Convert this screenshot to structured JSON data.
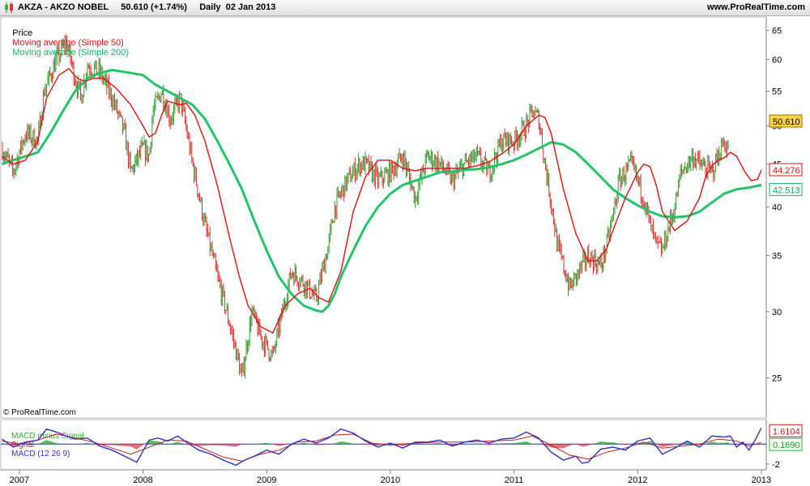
{
  "header": {
    "title": "AKZA - AKZO NOBEL     50.610 (+1.74%)     Daily  02 Jan 2013",
    "site": "www.ProRealTime.com"
  },
  "legend": {
    "price": "Price",
    "ma50": "Moving average (Simple 50)",
    "ma200": "Moving average (Simple 200)"
  },
  "macd_legend": {
    "hist": "MACD minus Signal",
    "signal": "Signal",
    "macd": "MACD (12 26 9)"
  },
  "credit": "© ProRealTime.com",
  "colors": {
    "price_up": "#2e9e2e",
    "price_down": "#d83030",
    "ma50": "#e01010",
    "ma200": "#22c46a",
    "macd": "#3030c0",
    "signal": "#c02020",
    "hist": "#30b030"
  },
  "chart_data": [
    {
      "type": "line",
      "name": "price-panel",
      "x_ticks": [
        "2007",
        "2008",
        "2009",
        "2010",
        "2011",
        "2012",
        "2013"
      ],
      "y_ticks": [
        25,
        30,
        35,
        40,
        45,
        50,
        55,
        60,
        65
      ],
      "y_scale": "log",
      "ylim": [
        22.5,
        67
      ],
      "xlim": [
        2006.85,
        2013.04
      ],
      "last_price_label": "50.610",
      "ma50_label": "44.276",
      "ma200_label": "42.513",
      "series": [
        {
          "name": "Price",
          "role": "price",
          "x": [
            2006.86,
            2006.95,
            2007.05,
            2007.15,
            2007.2,
            2007.3,
            2007.38,
            2007.45,
            2007.5,
            2007.55,
            2007.65,
            2007.75,
            2007.85,
            2007.9,
            2008.0,
            2008.05,
            2008.08,
            2008.15,
            2008.22,
            2008.3,
            2008.4,
            2008.5,
            2008.6,
            2008.7,
            2008.75,
            2008.8,
            2008.85,
            2008.88,
            2008.95,
            2009.05,
            2009.15,
            2009.2,
            2009.3,
            2009.4,
            2009.5,
            2009.55,
            2009.65,
            2009.75,
            2009.8,
            2009.9,
            2010.0,
            2010.1,
            2010.2,
            2010.3,
            2010.4,
            2010.5,
            2010.6,
            2010.7,
            2010.8,
            2010.9,
            2011.0,
            2011.1,
            2011.15,
            2011.2,
            2011.25,
            2011.35,
            2011.45,
            2011.55,
            2011.6,
            2011.7,
            2011.75,
            2011.8,
            2011.85,
            2011.95,
            2012.05,
            2012.1,
            2012.15,
            2012.2,
            2012.3,
            2012.35,
            2012.4,
            2012.45,
            2012.5,
            2012.6,
            2012.65,
            2012.7,
            2012.75,
            2012.8,
            2012.85,
            2012.9,
            2012.95,
            2013.0
          ],
          "values": [
            47,
            44,
            49,
            48,
            55,
            60,
            63,
            57,
            54,
            59,
            58,
            54,
            49,
            44,
            47,
            46,
            52,
            55,
            51,
            54,
            45,
            38,
            33,
            29,
            27,
            25,
            28,
            30,
            28,
            26.5,
            31,
            33.5,
            32.5,
            31,
            36,
            40,
            43,
            45,
            45,
            43,
            44,
            46,
            41,
            46,
            45,
            43,
            45,
            46,
            44,
            48,
            48,
            50,
            52,
            51,
            45,
            36,
            32,
            34,
            35,
            34,
            36,
            39,
            43,
            45,
            41,
            38,
            36,
            35.5,
            40,
            44,
            45,
            46,
            45,
            44,
            46,
            48,
            46,
            44,
            42,
            44,
            49,
            50.61
          ]
        },
        {
          "name": "Moving average (Simple 50)",
          "role": "ma50",
          "x": [
            2006.86,
            2006.95,
            2007.05,
            2007.15,
            2007.22,
            2007.32,
            2007.4,
            2007.47,
            2007.53,
            2007.6,
            2007.68,
            2007.78,
            2007.9,
            2008.0,
            2008.05,
            2008.1,
            2008.15,
            2008.2,
            2008.3,
            2008.35,
            2008.42,
            2008.5,
            2008.6,
            2008.7,
            2008.78,
            2008.85,
            2008.95,
            2009.05,
            2009.15,
            2009.25,
            2009.35,
            2009.42,
            2009.5,
            2009.6,
            2009.7,
            2009.8,
            2009.9,
            2010.0,
            2010.1,
            2010.2,
            2010.3,
            2010.4,
            2010.5,
            2010.6,
            2010.7,
            2010.8,
            2010.9,
            2011.0,
            2011.1,
            2011.2,
            2011.25,
            2011.3,
            2011.4,
            2011.5,
            2011.6,
            2011.67,
            2011.75,
            2011.8,
            2011.9,
            2012.0,
            2012.05,
            2012.1,
            2012.15,
            2012.2,
            2012.3,
            2012.4,
            2012.5,
            2012.55,
            2012.6,
            2012.65,
            2012.7,
            2012.75,
            2012.8,
            2012.87,
            2012.92,
            2012.97,
            2013.0
          ],
          "values": [
            46,
            45,
            45.5,
            48,
            54,
            57.5,
            58.5,
            57,
            56.5,
            57,
            57,
            55.5,
            53,
            50,
            48.5,
            49,
            51.5,
            53.5,
            53,
            53.2,
            51.5,
            48,
            42.5,
            36.8,
            33,
            30.5,
            28.8,
            28.3,
            30.5,
            31.5,
            32,
            31.2,
            30.8,
            33.5,
            39.5,
            43.5,
            45.5,
            45.5,
            44.5,
            44.2,
            44.5,
            44.5,
            44.5,
            44.5,
            44.8,
            45.3,
            46.3,
            47.5,
            50,
            51.5,
            51.2,
            49,
            42,
            37.2,
            34.5,
            34.5,
            35.7,
            37.5,
            41,
            44,
            45,
            44.7,
            42.5,
            39.5,
            37.5,
            38.5,
            41,
            43.5,
            44.8,
            45.5,
            45.8,
            46.5,
            46,
            44,
            43,
            43.2,
            44.28
          ]
        },
        {
          "name": "Moving average (Simple 200)",
          "role": "ma200",
          "x": [
            2006.86,
            2006.95,
            2007.05,
            2007.15,
            2007.25,
            2007.35,
            2007.45,
            2007.55,
            2007.65,
            2007.75,
            2007.85,
            2008.0,
            2008.1,
            2008.2,
            2008.3,
            2008.4,
            2008.5,
            2008.6,
            2008.7,
            2008.8,
            2008.9,
            2009.0,
            2009.1,
            2009.2,
            2009.3,
            2009.35,
            2009.4,
            2009.45,
            2009.5,
            2009.55,
            2009.6,
            2009.7,
            2009.8,
            2009.9,
            2010.0,
            2010.1,
            2010.2,
            2010.3,
            2010.4,
            2010.5,
            2010.6,
            2010.7,
            2010.8,
            2010.9,
            2011.0,
            2011.1,
            2011.2,
            2011.3,
            2011.4,
            2011.5,
            2011.6,
            2011.7,
            2011.8,
            2011.9,
            2012.0,
            2012.1,
            2012.2,
            2012.3,
            2012.4,
            2012.5,
            2012.6,
            2012.7,
            2012.8,
            2012.9,
            2013.0
          ],
          "values": [
            45,
            45.5,
            46,
            46.5,
            49,
            52,
            55,
            57,
            57.8,
            58.3,
            58,
            57.5,
            56,
            55,
            54,
            53,
            51,
            48,
            45,
            42,
            38.5,
            35.5,
            33,
            31.5,
            30.5,
            30.3,
            30.1,
            30,
            30.5,
            31.5,
            33,
            35.5,
            38,
            40,
            41.5,
            42.5,
            43,
            43.5,
            44,
            44.1,
            44.3,
            44.4,
            44.6,
            45,
            45.5,
            46.2,
            47,
            47.8,
            47.5,
            46.5,
            45,
            43.5,
            42,
            41,
            40.2,
            39.5,
            39,
            38.9,
            39,
            39.5,
            40.5,
            41.5,
            42,
            42.2,
            42.5
          ]
        }
      ]
    },
    {
      "type": "line",
      "name": "macd-panel",
      "y_ticks": [
        -2
      ],
      "ylim": [
        -2.4,
        2.2
      ],
      "macd_label": "1.6104",
      "signal_label": "0.1690",
      "series": [
        {
          "name": "MACD (12 26 9)",
          "role": "macd",
          "x": [
            2006.86,
            2006.95,
            2007.05,
            2007.15,
            2007.22,
            2007.3,
            2007.38,
            2007.45,
            2007.55,
            2007.65,
            2007.75,
            2007.85,
            2007.95,
            2008.05,
            2008.12,
            2008.2,
            2008.28,
            2008.35,
            2008.45,
            2008.55,
            2008.65,
            2008.75,
            2008.82,
            2008.9,
            2009.0,
            2009.1,
            2009.2,
            2009.3,
            2009.4,
            2009.5,
            2009.6,
            2009.7,
            2009.8,
            2009.9,
            2010.0,
            2010.1,
            2010.2,
            2010.3,
            2010.4,
            2010.5,
            2010.6,
            2010.7,
            2010.8,
            2010.9,
            2011.0,
            2011.1,
            2011.2,
            2011.3,
            2011.4,
            2011.5,
            2011.55,
            2011.6,
            2011.7,
            2011.8,
            2011.9,
            2012.0,
            2012.1,
            2012.2,
            2012.3,
            2012.4,
            2012.5,
            2012.6,
            2012.7,
            2012.75,
            2012.8,
            2012.85,
            2012.9,
            2012.95,
            2013.0
          ],
          "values": [
            0.5,
            -0.3,
            0.2,
            0.4,
            1.5,
            1.2,
            0.8,
            0.5,
            0.6,
            -0.2,
            -0.6,
            -1.2,
            -1.8,
            0.4,
            0.6,
            0.3,
            0.8,
            0.2,
            -0.6,
            -1.0,
            -1.6,
            -2.1,
            -1.6,
            -1.2,
            -0.6,
            -1.0,
            0.0,
            0.5,
            0.1,
            0.6,
            1.5,
            1.1,
            0.3,
            -0.3,
            0.1,
            -0.4,
            0.2,
            0.2,
            0.4,
            -0.2,
            0.2,
            0.4,
            0.1,
            0.5,
            0.6,
            1.2,
            0.6,
            -0.8,
            -1.6,
            -1.2,
            -1.9,
            -1.8,
            -0.5,
            -0.3,
            -0.6,
            0.3,
            0.6,
            -1.0,
            -0.4,
            0.3,
            -0.3,
            0.8,
            0.7,
            0.8,
            -0.3,
            0.2,
            -0.6,
            0.4,
            1.6104
          ]
        },
        {
          "name": "Signal",
          "role": "signal",
          "x": [
            2006.86,
            2007.0,
            2007.15,
            2007.3,
            2007.45,
            2007.6,
            2007.75,
            2007.9,
            2008.05,
            2008.2,
            2008.35,
            2008.5,
            2008.65,
            2008.8,
            2008.95,
            2009.1,
            2009.25,
            2009.4,
            2009.55,
            2009.7,
            2009.85,
            2010.0,
            2010.2,
            2010.4,
            2010.6,
            2010.8,
            2011.0,
            2011.15,
            2011.3,
            2011.45,
            2011.6,
            2011.75,
            2011.9,
            2012.05,
            2012.2,
            2012.35,
            2012.5,
            2012.65,
            2012.8,
            2012.9,
            2013.0
          ],
          "values": [
            0.3,
            0.0,
            0.4,
            1.0,
            0.6,
            0.2,
            -0.4,
            -1.0,
            -0.3,
            0.4,
            0.3,
            -0.5,
            -1.3,
            -1.7,
            -1.0,
            -0.6,
            0.2,
            0.3,
            0.9,
            1.0,
            0.1,
            -0.1,
            0.1,
            0.2,
            0.2,
            0.3,
            0.4,
            0.8,
            -0.1,
            -1.1,
            -1.5,
            -0.8,
            -0.4,
            0.2,
            -0.4,
            -0.2,
            0.0,
            0.5,
            0.3,
            -0.2,
            0.169
          ]
        }
      ]
    }
  ]
}
